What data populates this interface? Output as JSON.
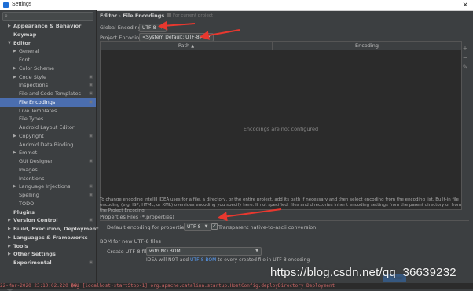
{
  "window": {
    "title": "Settings",
    "close_glyph": "✕"
  },
  "sidebar": {
    "search_placeholder": "",
    "items": [
      {
        "label": "Appearance & Behavior"
      },
      {
        "label": "Keymap"
      },
      {
        "label": "Editor"
      },
      {
        "label": "General"
      },
      {
        "label": "Font"
      },
      {
        "label": "Color Scheme"
      },
      {
        "label": "Code Style"
      },
      {
        "label": "Inspections"
      },
      {
        "label": "File and Code Templates"
      },
      {
        "label": "File Encodings"
      },
      {
        "label": "Live Templates"
      },
      {
        "label": "File Types"
      },
      {
        "label": "Android Layout Editor"
      },
      {
        "label": "Copyright"
      },
      {
        "label": "Android Data Binding"
      },
      {
        "label": "Emmet"
      },
      {
        "label": "GUI Designer"
      },
      {
        "label": "Images"
      },
      {
        "label": "Intentions"
      },
      {
        "label": "Language Injections"
      },
      {
        "label": "Spelling"
      },
      {
        "label": "TODO"
      },
      {
        "label": "Plugins"
      },
      {
        "label": "Version Control"
      },
      {
        "label": "Build, Execution, Deployment"
      },
      {
        "label": "Languages & Frameworks"
      },
      {
        "label": "Tools"
      },
      {
        "label": "Other Settings"
      },
      {
        "label": "Experimental"
      }
    ],
    "help_glyph": "?"
  },
  "main": {
    "breadcrumb": {
      "parent": "Editor",
      "separator": "›",
      "current": "File Encodings"
    },
    "scope_note": "For current project",
    "global_encoding": {
      "label": "Global Encoding:",
      "value": "UTF-8"
    },
    "project_encoding": {
      "label": "Project Encoding:",
      "value": "<System Default: UTF-8>"
    },
    "table": {
      "columns": [
        "Path",
        "Encoding"
      ],
      "sort_glyph": "▲",
      "empty_text": "Encodings are not configured",
      "tools": [
        "+",
        "−",
        "✎"
      ]
    },
    "info_text": "To change encoding IntelliJ IDEA uses for a file, a directory, or the entire project, add its path if necessary and then select encoding from the encoding list. Built-in file encoding (e.g. ISP, HTML, or XML) overrides encoding you specify here. If not specified, files and directories inherit encoding settings from the parent directory or from the Project Encoding.",
    "properties_files": {
      "title": "Properties Files (*.properties)",
      "default_label": "Default encoding for properties files:",
      "default_value": "UTF-8",
      "native_checkbox_label": "Transparent native-to-ascii conversion",
      "native_checked": true
    },
    "bom": {
      "title": "BOM for new UTF-8 files",
      "create_label": "Create UTF-8 files:",
      "create_value": "with NO BOM",
      "note_prefix": "IDEA will NOT add",
      "note_link": "UTF-8 BOM",
      "note_suffix": "to every created file in UTF-8 encoding"
    }
  },
  "overlay": {
    "watermark": "https://blog.csdn.net/qq_36639232",
    "log_text": "22-Mar-2020 23:10:02.220 ��Ϣ [localhost-startStop-1] org.apache.catalina.startup.HostConfig.deployDirectory Deployment"
  },
  "colors": {
    "accent": "#4b6eaf",
    "arrow": "#e8382f",
    "link": "#589df6"
  }
}
